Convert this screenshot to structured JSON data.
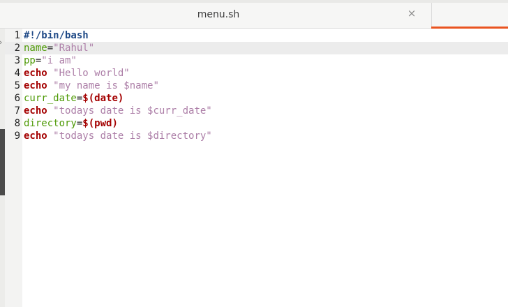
{
  "tab": {
    "title": "menu.sh",
    "close_glyph": "×"
  },
  "editor": {
    "current_line": 2,
    "lines": [
      {
        "number": "1",
        "tokens": [
          {
            "text": "#!/bin/bash",
            "kind": "shebang"
          }
        ]
      },
      {
        "number": "2",
        "tokens": [
          {
            "text": "name",
            "kind": "var"
          },
          {
            "text": "=",
            "kind": "op"
          },
          {
            "text": "\"Rahul\"",
            "kind": "str"
          }
        ]
      },
      {
        "number": "3",
        "tokens": [
          {
            "text": "pp",
            "kind": "var"
          },
          {
            "text": "=",
            "kind": "op"
          },
          {
            "text": "\"i am\"",
            "kind": "str"
          }
        ]
      },
      {
        "number": "4",
        "tokens": [
          {
            "text": "echo",
            "kind": "kw"
          },
          {
            "text": " ",
            "kind": "op"
          },
          {
            "text": "\"Hello world\"",
            "kind": "str"
          }
        ]
      },
      {
        "number": "5",
        "tokens": [
          {
            "text": "echo",
            "kind": "kw"
          },
          {
            "text": " ",
            "kind": "op"
          },
          {
            "text": "\"my name is $name\"",
            "kind": "str"
          }
        ]
      },
      {
        "number": "6",
        "tokens": [
          {
            "text": "curr_date",
            "kind": "var"
          },
          {
            "text": "=",
            "kind": "op"
          },
          {
            "text": "$(date)",
            "kind": "kw"
          }
        ]
      },
      {
        "number": "7",
        "tokens": [
          {
            "text": "echo",
            "kind": "kw"
          },
          {
            "text": " ",
            "kind": "op"
          },
          {
            "text": "\"todays date is $curr_date\"",
            "kind": "str"
          }
        ]
      },
      {
        "number": "8",
        "tokens": [
          {
            "text": "directory",
            "kind": "var"
          },
          {
            "text": "=",
            "kind": "op"
          },
          {
            "text": "$(pwd)",
            "kind": "kw"
          }
        ]
      },
      {
        "number": "9",
        "tokens": [
          {
            "text": "echo",
            "kind": "kw"
          },
          {
            "text": " ",
            "kind": "op"
          },
          {
            "text": "\"todays date is $directory\"",
            "kind": "str"
          }
        ]
      }
    ]
  },
  "colors": {
    "accent": "#e95420",
    "keyword": "#a40000",
    "variable": "#4e9a06",
    "string": "#ad7fa8",
    "shebang": "#204a87"
  }
}
